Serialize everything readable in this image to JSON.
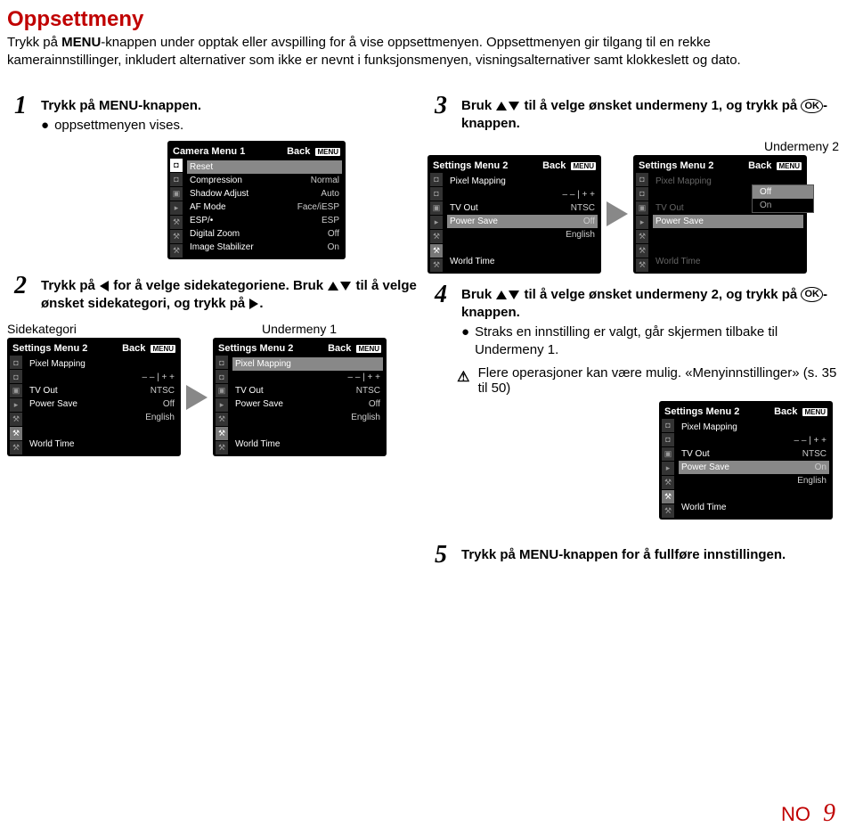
{
  "page": {
    "title": "Oppsettmeny",
    "intro_1": "Trykk på ",
    "intro_menu": "MENU",
    "intro_2": "-knappen under opptak eller avspilling for å vise oppsettmenyen. Oppsettmenyen gir tilgang til en rekke kamerainnstillinger, inkludert alternativer som ikke er nevnt i funksjonsmenyen, visningsalternativer samt klokkeslett og dato.",
    "footer_no": "NO",
    "footer_page": "9"
  },
  "steps": {
    "s1": {
      "num": "1",
      "text_a": "Trykk på ",
      "text_menu": "MENU",
      "text_b": "-knappen.",
      "bullet": "oppsettmenyen vises."
    },
    "s2": {
      "num": "2",
      "text": "Trykk på ◁ for å velge sidekategoriene. Bruk △▽ til å velge ønsket sidekategori, og trykk på ▷.",
      "label_side": "Sidekategori",
      "label_under1": "Undermeny 1"
    },
    "s3": {
      "num": "3",
      "text": "Bruk △▽ til å velge ønsket undermeny 1, og trykk på OK-knappen.",
      "label_under2": "Undermeny 2"
    },
    "s4": {
      "num": "4",
      "text": "Bruk △▽ til å velge ønsket undermeny 2, og trykk på OK-knappen.",
      "bullet": "Straks en innstilling er valgt, går skjermen tilbake til Undermeny 1.",
      "note": "Flere operasjoner kan være mulig. «Menyinnstillinger» (s. 35 til 50)"
    },
    "s5": {
      "num": "5",
      "text_a": "Trykk på ",
      "text_menu": "MENU",
      "text_b": "-knappen for å fullføre innstillingen."
    }
  },
  "screens": {
    "back": "Back",
    "menu_tag": "MENU",
    "camera": {
      "title": "Camera Menu 1",
      "rows": [
        {
          "l": "Reset",
          "r": ""
        },
        {
          "l": "Compression",
          "r": "Normal"
        },
        {
          "l": "Shadow Adjust",
          "r": "Auto"
        },
        {
          "l": "AF Mode",
          "r": "Face/iESP"
        },
        {
          "l": "ESP/•",
          "r": "ESP"
        },
        {
          "l": "Digital Zoom",
          "r": "Off"
        },
        {
          "l": "Image Stabilizer",
          "r": "On"
        }
      ]
    },
    "settings": {
      "title": "Settings Menu 2",
      "rows": [
        {
          "l": "Pixel Mapping",
          "r": ""
        },
        {
          "l": "",
          "r": "– – | + +"
        },
        {
          "l": "TV Out",
          "r": "NTSC"
        },
        {
          "l": "Power Save",
          "r": "Off"
        },
        {
          "l": "",
          "r": "English"
        },
        {
          "l": "",
          "r": ""
        },
        {
          "l": "World Time",
          "r": ""
        }
      ]
    },
    "settings_on": {
      "rows": [
        {
          "l": "Pixel Mapping",
          "r": ""
        },
        {
          "l": "",
          "r": "– – | + +"
        },
        {
          "l": "TV Out",
          "r": "NTSC"
        },
        {
          "l": "Power Save",
          "r": "On"
        },
        {
          "l": "",
          "r": "English"
        },
        {
          "l": "",
          "r": ""
        },
        {
          "l": "World Time",
          "r": ""
        }
      ]
    },
    "popup": {
      "off": "Off",
      "on": "On"
    }
  }
}
